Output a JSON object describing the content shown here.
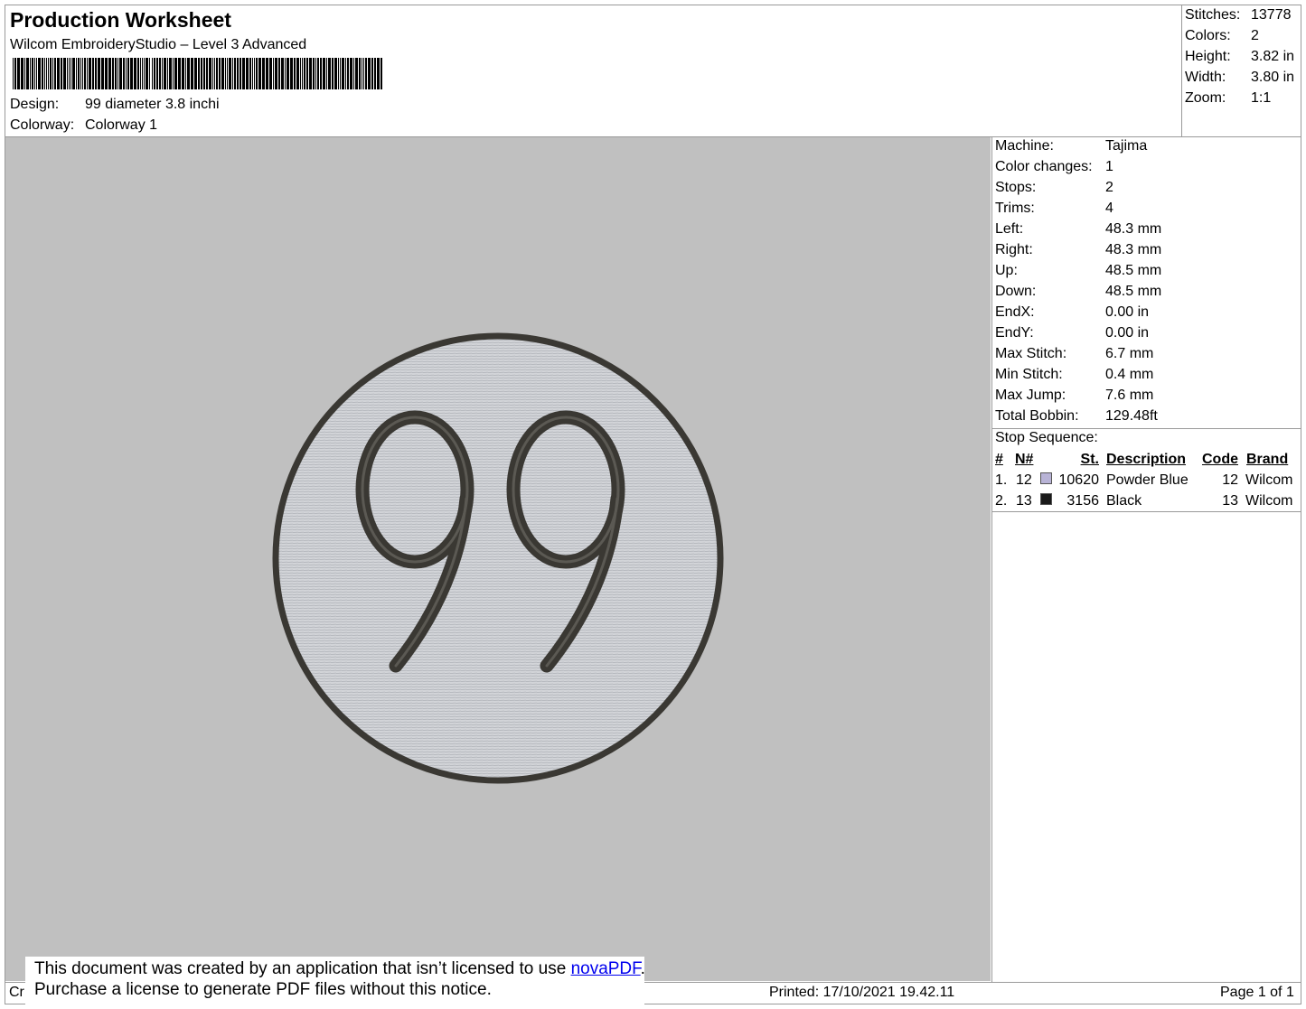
{
  "header": {
    "title": "Production Worksheet",
    "software": "Wilcom EmbroideryStudio – Level 3 Advanced",
    "design_label": "Design:",
    "design_value": "99 diameter 3.8 inchi",
    "colorway_label": "Colorway:",
    "colorway_value": "Colorway 1"
  },
  "summary": [
    {
      "label": "Stitches:",
      "value": "13778"
    },
    {
      "label": "Colors:",
      "value": "2"
    },
    {
      "label": "Height:",
      "value": "3.82 in"
    },
    {
      "label": "Width:",
      "value": "3.80 in"
    },
    {
      "label": "Zoom:",
      "value": "1:1"
    }
  ],
  "details": [
    {
      "label": "Machine:",
      "value": "Tajima"
    },
    {
      "label": "Color changes:",
      "value": "1"
    },
    {
      "label": "Stops:",
      "value": "2"
    },
    {
      "label": "Trims:",
      "value": "4"
    },
    {
      "label": "Left:",
      "value": "48.3 mm"
    },
    {
      "label": "Right:",
      "value": "48.3 mm"
    },
    {
      "label": "Up:",
      "value": "48.5 mm"
    },
    {
      "label": "Down:",
      "value": "48.5 mm"
    },
    {
      "label": "EndX:",
      "value": "0.00 in"
    },
    {
      "label": "EndY:",
      "value": "0.00 in"
    },
    {
      "label": "Max Stitch:",
      "value": "6.7 mm"
    },
    {
      "label": "Min Stitch:",
      "value": "0.4 mm"
    },
    {
      "label": "Max Jump:",
      "value": "7.6 mm"
    },
    {
      "label": "Total Bobbin:",
      "value": "129.48ft"
    }
  ],
  "stop_sequence": {
    "title": "Stop Sequence:",
    "headers": {
      "num": "#",
      "n": "N#",
      "st": "St.",
      "desc": "Description",
      "code": "Code",
      "brand": "Brand"
    },
    "rows": [
      {
        "num": "1.",
        "n": "12",
        "color": "#b8b3d6",
        "st": "10620",
        "desc": "Powder Blue",
        "code": "12",
        "brand": "Wilcom"
      },
      {
        "num": "2.",
        "n": "13",
        "color": "#1a1a1a",
        "st": "3156",
        "desc": "Black",
        "code": "13",
        "brand": "Wilcom"
      }
    ]
  },
  "design_preview": {
    "text": "99",
    "background_color": "#c0c0c0",
    "fill_color": "#d2d4d8",
    "outline_color": "#3a3833"
  },
  "notice": {
    "line1_prefix": "This document was created by an application that isn’t licensed to use ",
    "link": "novaPDF",
    "line1_suffix": ".",
    "line2": "Purchase a license to generate PDF files without this notice."
  },
  "footer": {
    "left": "Cr",
    "printed": "Printed: 17/10/2021 19.42.11",
    "page": "Page 1 of 1"
  }
}
